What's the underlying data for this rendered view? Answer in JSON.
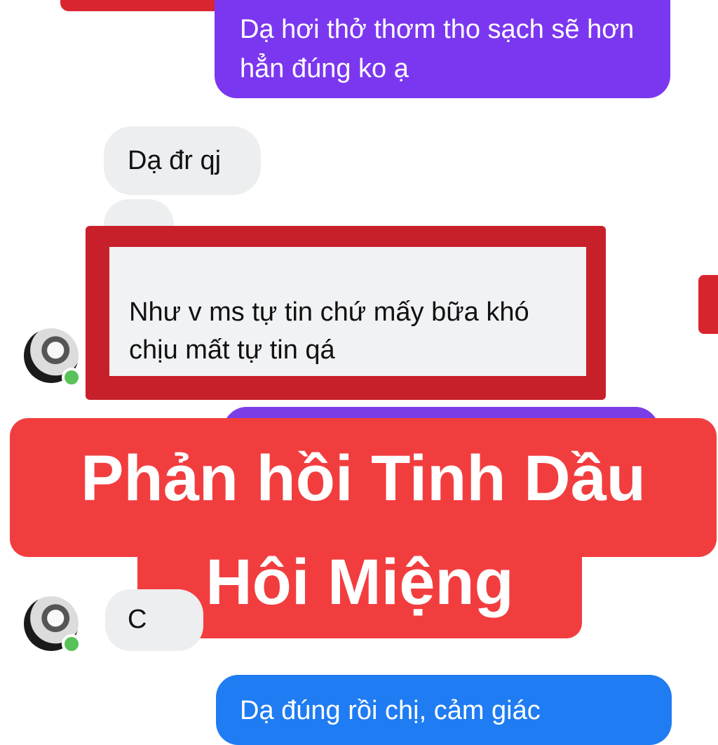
{
  "conversation": {
    "messages": [
      {
        "direction": "outgoing",
        "text": "Dạ hơi thở thơm tho sạch sẽ hơn hẳn đúng ko ạ"
      },
      {
        "direction": "incoming",
        "text": "Dạ đr qj"
      },
      {
        "direction": "incoming",
        "text": "Như v ms tự tin chứ mấy bữa khó chịu mất tự tin qá",
        "highlighted": true
      },
      {
        "direction": "incoming",
        "text": "C"
      },
      {
        "direction": "outgoing",
        "text": "Dạ đúng rồi chị, cảm giác"
      }
    ]
  },
  "overlay": {
    "title_line1": "Phản hồi Tinh Dầu",
    "title_line2": "Hôi Miệng"
  },
  "colors": {
    "outgoing_purple": "#7b37f0",
    "outgoing_blue": "#1f7cf2",
    "incoming_gray": "#eceef0",
    "highlight_red": "#c8202a",
    "banner_red": "#f23d3f",
    "online_green": "#58c25a"
  }
}
